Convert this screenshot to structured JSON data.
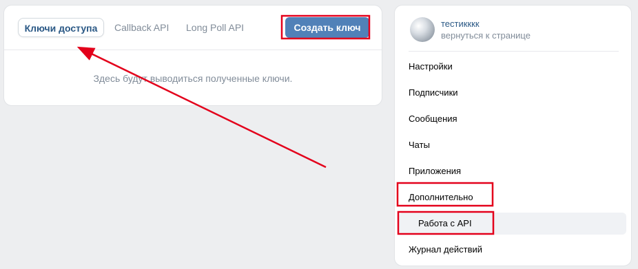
{
  "tabs": [
    {
      "label": "Ключи доступа",
      "active": true
    },
    {
      "label": "Callback API",
      "active": false
    },
    {
      "label": "Long Poll API",
      "active": false
    }
  ],
  "create_button_label": "Создать ключ",
  "empty_message": "Здесь будут выводиться полученные ключи.",
  "profile": {
    "name": "тестикккк",
    "back_link": "вернуться к странице"
  },
  "menu": [
    {
      "label": "Настройки"
    },
    {
      "label": "Подписчики"
    },
    {
      "label": "Сообщения"
    },
    {
      "label": "Чаты"
    },
    {
      "label": "Приложения"
    },
    {
      "label": "Дополнительно"
    },
    {
      "label": "Работа с API",
      "selected": true
    },
    {
      "label": "Журнал действий"
    }
  ],
  "colors": {
    "accent": "#5181b8",
    "link": "#2a5885",
    "annotation": "#e3001b",
    "background": "#edeef0"
  }
}
